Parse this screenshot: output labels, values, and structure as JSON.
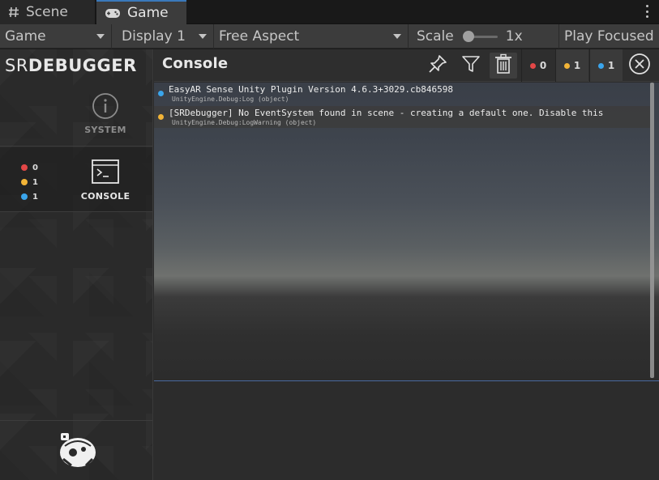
{
  "tabs": [
    {
      "label": "Scene",
      "icon": "hash-icon",
      "active": false
    },
    {
      "label": "Game",
      "icon": "gamepad-icon",
      "active": true
    }
  ],
  "toolbar": {
    "game_view": "Game",
    "display": "Display 1",
    "aspect": "Free Aspect",
    "scale_label": "Scale",
    "scale_value": "1x",
    "play_mode": "Play Focused"
  },
  "debugger": {
    "logo_sr": "SR",
    "logo_debugger": "DEBUGGER",
    "nav": {
      "system_label": "SYSTEM",
      "console_label": "CONSOLE",
      "counts": {
        "errors": "0",
        "warnings": "1",
        "info": "1"
      }
    },
    "console": {
      "title": "Console",
      "counters": {
        "errors": "0",
        "warnings": "1",
        "info": "1"
      },
      "entries": [
        {
          "level": "info",
          "message": "EasyAR Sense Unity Plugin Version 4.6.3+3029.cb846598",
          "source": "UnityEngine.Debug:Log (object)"
        },
        {
          "level": "warning",
          "message": "[SRDebugger] No EventSystem found in scene - creating a default one. Disable this",
          "source": "UnityEngine.Debug:LogWarning (object)"
        }
      ]
    }
  },
  "colors": {
    "accent": "#3a79bb",
    "error": "#e34747",
    "warning": "#f2b437",
    "info": "#3aa5ec"
  }
}
